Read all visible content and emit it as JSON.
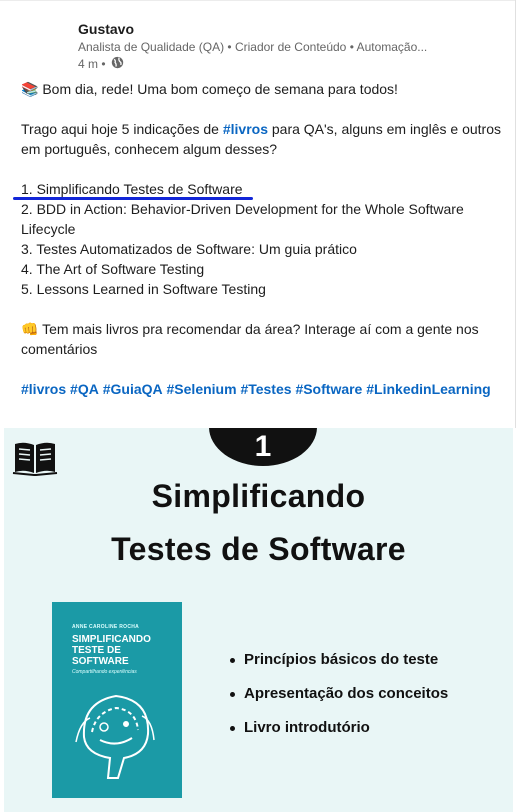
{
  "post": {
    "author_name": "Gustavo",
    "headline": "Analista de Qualidade (QA) • Criador de Conteúdo • Automação...",
    "time": "4 m •",
    "paragraphs": {
      "greeting": "📚 Bom dia, rede! Uma bom começo de semana para todos!",
      "intro": "Trago aqui hoje 5 indicações de",
      "intro_tag": "#livros",
      "intro_rest": "para QA's, alguns em inglês e outros em português, conhecem algum desses?",
      "list": [
        "1. Simplificando Testes de Software",
        "2. BDD in Action: Behavior-Driven Development for the Whole Software Lifecycle",
        "3. Testes Automatizados de Software: Um guia prático",
        "4. The Art of Software Testing",
        "5. Lessons Learned in Software Testing"
      ],
      "cta": "👊 Tem mais livros pra recomendar da área? Interage aí com a gente nos comentários"
    },
    "hashtags": [
      "#livros",
      "#QA",
      "#GuiaQA",
      "#Selenium",
      "#Testes",
      "#Software",
      "#LinkedinLearning"
    ]
  },
  "slide": {
    "badge": "1",
    "title_line1": "Simplificando",
    "title_line2": "Testes de Software",
    "cover": {
      "author": "ANNE CAROLINE ROCHA",
      "title": "SIMPLIFICANDO TESTE DE SOFTWARE",
      "subtitle": "Compartilhando experiências"
    },
    "bullets": [
      "Princípios básicos do teste",
      "Apresentação dos conceitos",
      "Livro introdutório"
    ]
  },
  "colors": {
    "link": "#0a66c2",
    "underline": "#1226d8",
    "slide_bg": "#e9f6f6",
    "cover": "#1b9aa6"
  }
}
